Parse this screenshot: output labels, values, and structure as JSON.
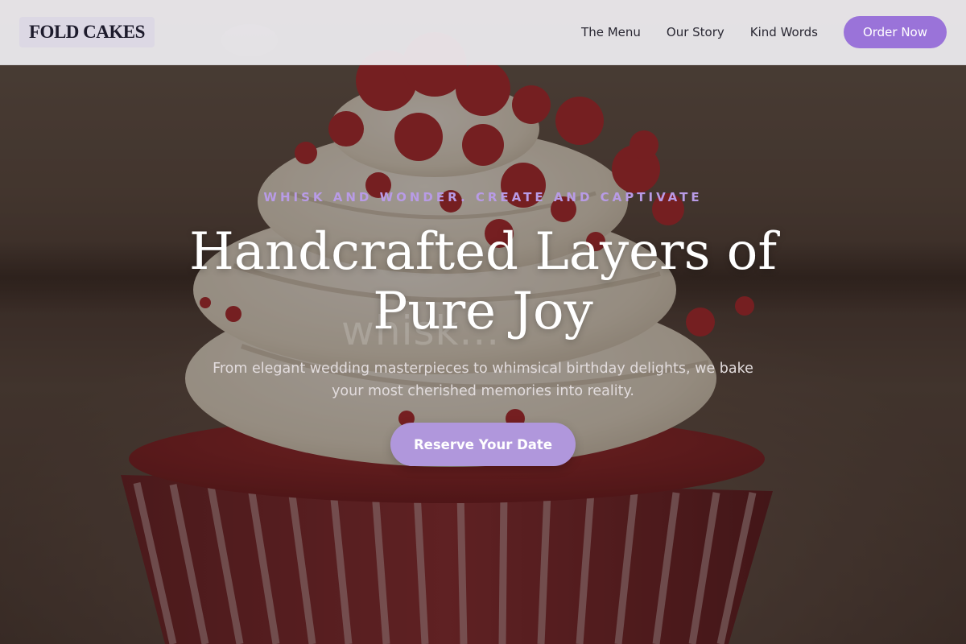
{
  "brand": {
    "logo_text": "FOLD CAKES"
  },
  "nav": {
    "links": [
      "The Menu",
      "Our Story",
      "Kind Words"
    ],
    "order_label": "Order Now"
  },
  "hero": {
    "eyebrow": "WHISK AND WONDER. CREATE AND CAPTIVATE",
    "headline": "Handcrafted Layers of Pure Joy",
    "ghost_text": "whisk...",
    "subtext": "From elegant wedding masterpieces to whimsical birthday delights, we bake your most cherished memories into reality.",
    "cta_label": "Reserve Your Date",
    "background_image": "red velvet cupcake with cream cheese frosting"
  },
  "colors": {
    "accent": "#9a73d9",
    "cta": "#b097dc",
    "eyebrow": "#b89be6",
    "nav_bg": "#eceaee",
    "logo_bg": "#dcd8e4"
  }
}
